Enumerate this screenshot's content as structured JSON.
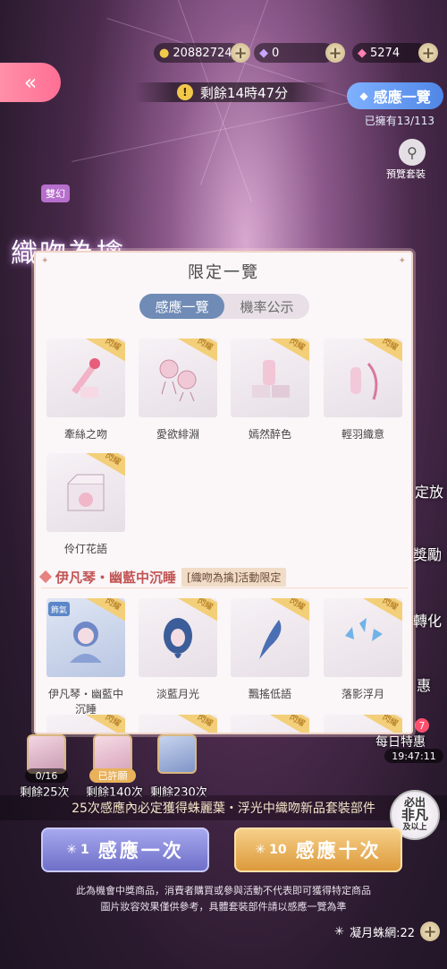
{
  "header": {
    "gold": "20882724",
    "diamond": "0",
    "crystal": "5274",
    "back_icon": "double-chevron-left",
    "timer": "剩餘14時47分",
    "gallery_label": "感應一覽",
    "owned_text": "已擁有13/113",
    "preview_label": "預覽套裝"
  },
  "left_panel": {
    "badge": "雙幻",
    "title": "織吻為擒"
  },
  "side_labels": [
    "定放",
    "獎勵",
    "轉化",
    "惠",
    "每日特惠"
  ],
  "side_timer": "19:47:11",
  "side_badge": "7",
  "popup": {
    "title": "限定一覽",
    "tabs": [
      {
        "label": "感應一覽",
        "active": true
      },
      {
        "label": "機率公示",
        "active": false
      }
    ],
    "ribbon_text": "閃耀",
    "items": [
      {
        "name": "牽絲之吻"
      },
      {
        "name": "愛欲緋淵"
      },
      {
        "name": "嫣然醉色"
      },
      {
        "name": "輕羽織意"
      },
      {
        "name": "伶仃花語"
      }
    ],
    "section_title": "伊凡琴・幽藍中沉睡",
    "section_tag": "[織吻為擒]活動限定",
    "outfit_badge": "飾氣",
    "section_items": [
      {
        "name": "伊凡琴・幽藍中沉睡"
      },
      {
        "name": "淡藍月光"
      },
      {
        "name": "飄搖低語"
      },
      {
        "name": "落影浮月"
      }
    ]
  },
  "pool": {
    "items": [
      {
        "count": "0/16",
        "label": "剩餘25次"
      },
      {
        "count": "已許願",
        "label": "剩餘140次"
      },
      {
        "count": "",
        "label": "剩餘230次"
      }
    ]
  },
  "promo": {
    "text": "25次感應內必定獲得蛛麗葉・浮光中織吻新品套裝部件",
    "stamp_line1": "必出",
    "stamp_line2": "非凡",
    "stamp_line3": "及以上"
  },
  "buttons": {
    "draw_one_count": "1",
    "draw_one_label": "感應一次",
    "draw_ten_count": "10",
    "draw_ten_label": "感應十次"
  },
  "disclaimer": {
    "line1": "此為機會中獎商品，消費者購買或參與活動不代表即可獲得特定商品",
    "line2": "圖片妝容效果僅供參考，具體套裝部件請以感應一覽為準"
  },
  "bottom_currency": "凝月蛛網:22",
  "colors": {
    "accent_blue": "#6f8bb6",
    "back_pink": "#ff6f94",
    "gold_button": "#e8b15a",
    "purple_button": "#7a7bd0"
  }
}
